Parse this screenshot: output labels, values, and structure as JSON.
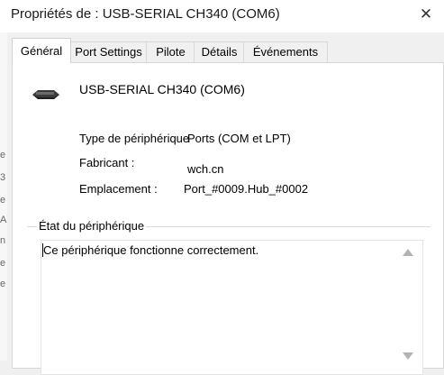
{
  "window": {
    "title": "Propriétés de : USB-SERIAL CH340 (COM6)",
    "close_glyph": "✕",
    "close_icon": "close-icon"
  },
  "left_strip": {
    "fragments": [
      "e",
      "3",
      "e",
      "A",
      "n",
      "e",
      "e"
    ]
  },
  "tabs": [
    {
      "label": "Général",
      "active": true
    },
    {
      "label": "Port Settings",
      "active": false
    },
    {
      "label": "Pilote",
      "active": false
    },
    {
      "label": "Détails",
      "active": false
    },
    {
      "label": "Événements",
      "active": false
    }
  ],
  "general": {
    "device_icon": "usb-serial-device-icon",
    "device_name": "USB-SERIAL CH340 (COM6)",
    "type_label": "Type de périphérique",
    "type_value": "Ports (COM et LPT)",
    "manufacturer_label": "Fabricant :",
    "manufacturer_value": "wch.cn",
    "location_label": "Emplacement :",
    "location_value": "Port_#0009.Hub_#0002",
    "status_group_label": "État du périphérique",
    "status_text": "Ce périphérique fonctionne correctement."
  }
}
